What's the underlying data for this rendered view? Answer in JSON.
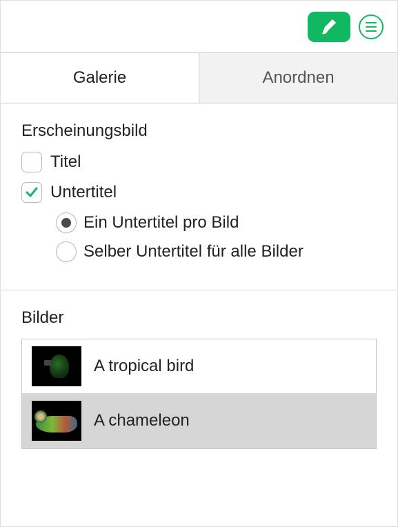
{
  "toolbar": {
    "format_icon": "paintbrush",
    "menu_icon": "list-circle"
  },
  "tabs": [
    {
      "id": "gallery",
      "label": "Galerie",
      "active": true
    },
    {
      "id": "arrange",
      "label": "Anordnen",
      "active": false
    }
  ],
  "appearance": {
    "heading": "Erscheinungsbild",
    "title_checkbox": {
      "label": "Titel",
      "checked": false
    },
    "caption_checkbox": {
      "label": "Untertitel",
      "checked": true
    },
    "caption_mode": {
      "options": [
        {
          "id": "per-image",
          "label": "Ein Untertitel pro Bild",
          "selected": true
        },
        {
          "id": "shared",
          "label": "Selber Untertitel für alle Bilder",
          "selected": false
        }
      ]
    }
  },
  "images_section": {
    "heading": "Bilder",
    "items": [
      {
        "caption": "A tropical bird",
        "thumb": "bird",
        "selected": false
      },
      {
        "caption": "A chameleon",
        "thumb": "chameleon",
        "selected": true
      }
    ]
  }
}
